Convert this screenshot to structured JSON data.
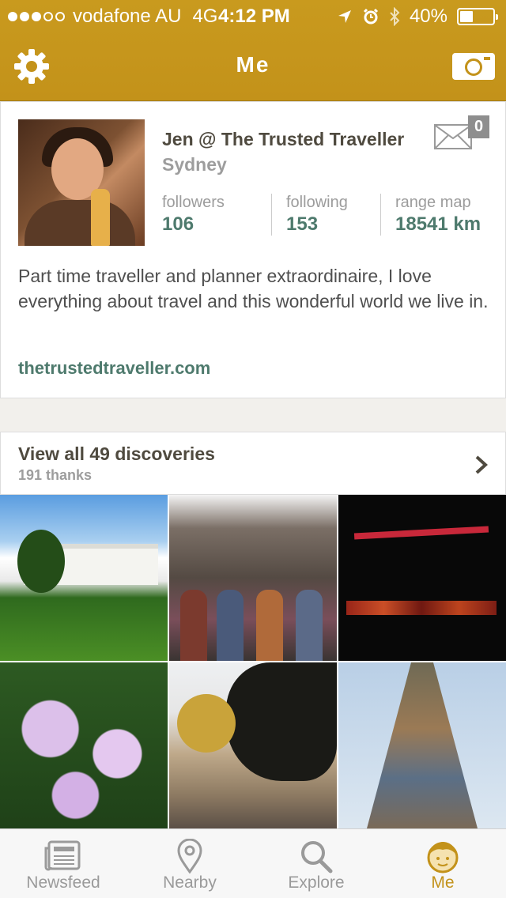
{
  "status_bar": {
    "carrier": "vodafone AU",
    "network": "4G",
    "time": "4:12 PM",
    "battery": "40%",
    "battery_level": 0.4,
    "signal_bars_filled": 3,
    "signal_bars_total": 5
  },
  "nav": {
    "title": "Me",
    "left_icon": "gear-icon",
    "right_icon": "camera-icon"
  },
  "profile": {
    "name": "Jen @ The Trusted Traveller",
    "city": "Sydney",
    "mail_count": "0",
    "stats": [
      {
        "label": "followers",
        "value": "106"
      },
      {
        "label": "following",
        "value": "153"
      },
      {
        "label": "range map",
        "value": "18541 km"
      }
    ],
    "bio": "Part time traveller and planner extraordinaire, I love everything about travel and this wonderful world we live in.",
    "website": "thetrustedtraveller.com"
  },
  "discoveries": {
    "title": "View all 49 discoveries",
    "subtitle": "191 thanks"
  },
  "tabs": [
    {
      "label": "Newsfeed",
      "icon": "newspaper-icon",
      "active": false
    },
    {
      "label": "Nearby",
      "icon": "map-pin-icon",
      "active": false
    },
    {
      "label": "Explore",
      "icon": "search-icon",
      "active": false
    },
    {
      "label": "Me",
      "icon": "face-icon",
      "active": true
    }
  ],
  "colors": {
    "header": "#c3921a",
    "accent_green": "#4e7a6d",
    "active_tab": "#c3921a"
  }
}
